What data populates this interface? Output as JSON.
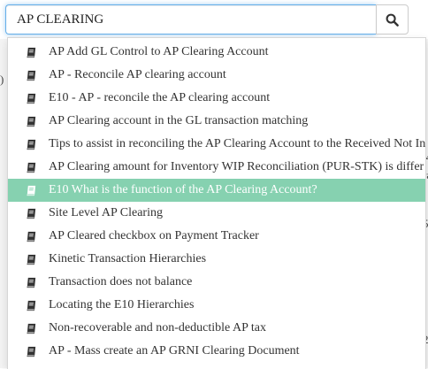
{
  "search": {
    "value": "AP CLEARING",
    "button_icon": "search-icon"
  },
  "dropdown": {
    "item_icon": "book-icon",
    "active_index": 6,
    "colors": {
      "active_bg": "#86d1b0",
      "active_text": "#ffffff",
      "focus_border": "#66afe9"
    },
    "items": [
      {
        "label": "AP Add GL Control to AP Clearing Account"
      },
      {
        "label": "AP - Reconcile AP clearing account"
      },
      {
        "label": "E10 - AP - reconcile the AP clearing account"
      },
      {
        "label": "AP Clearing account in the GL transaction matching"
      },
      {
        "label": "Tips to assist in reconciling the AP Clearing Account to the Received Not In"
      },
      {
        "label": "AP Clearing amount for Inventory WIP Reconciliation (PUR-STK) is differ"
      },
      {
        "label": "E10 What is the function of the AP Clearing Account?"
      },
      {
        "label": "Site Level AP Clearing"
      },
      {
        "label": "AP Cleared checkbox on Payment Tracker"
      },
      {
        "label": "Kinetic Transaction Hierarchies"
      },
      {
        "label": "Transaction does not balance"
      },
      {
        "label": "Locating the E10 Hierarchies"
      },
      {
        "label": "Non-recoverable and non-deductible AP tax"
      },
      {
        "label": "AP - Mass create an AP GRNI Clearing Document"
      }
    ]
  },
  "background": {
    "left_fragment": ")",
    "right_fragments": [
      "/4",
      "ra",
      "52",
      "2"
    ]
  }
}
